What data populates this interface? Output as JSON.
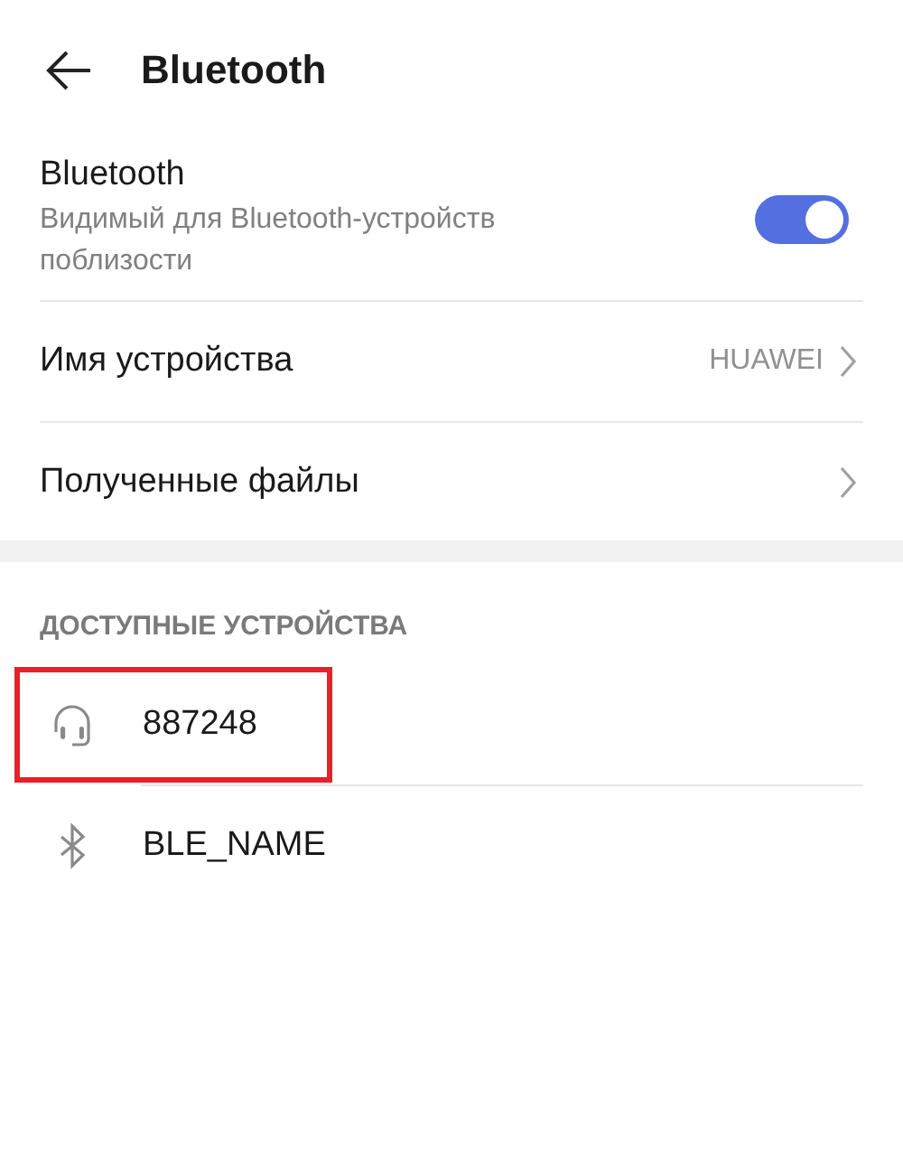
{
  "header": {
    "title": "Bluetooth"
  },
  "bluetooth": {
    "title": "Bluetooth",
    "subtitle": "Видимый для Bluetooth-устройств поблизости",
    "on": true
  },
  "settings": [
    {
      "label": "Имя устройства",
      "value": "HUAWEI"
    },
    {
      "label": "Полученные файлы"
    }
  ],
  "available_devices": {
    "heading": "ДОСТУПНЫЕ УСТРОЙСТВА",
    "devices": [
      {
        "name": "887248",
        "kind": "headphones",
        "highlighted": true
      },
      {
        "name": "BLE_NAME",
        "kind": "bluetooth",
        "highlighted": false
      }
    ]
  }
}
